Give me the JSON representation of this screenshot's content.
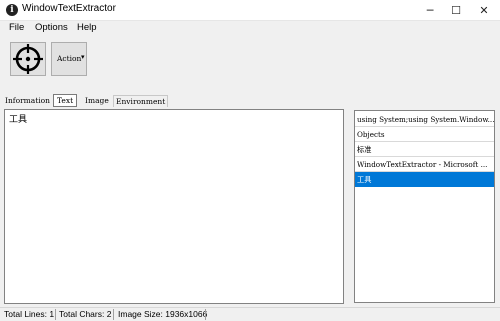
{
  "window": {
    "title": "WindowTextExtractor",
    "app_icon_glyph": "i",
    "minimize_glyph": "─",
    "maximize_glyph": "☐",
    "close_glyph": "✕"
  },
  "menu": {
    "items": [
      "File",
      "Options",
      "Help"
    ]
  },
  "toolbar": {
    "target_icon": "crosshair-target-icon",
    "action_label": "Action",
    "action_dropdown_glyph": "▾"
  },
  "tabs": {
    "items": [
      "Information",
      "Text",
      "Image",
      "Environment"
    ],
    "selected": "Text"
  },
  "text_panel": {
    "content": "工具"
  },
  "list": {
    "items": [
      "using System;using System.Window...",
      "Objects",
      "标准",
      "WindowTextExtractor - Microsoft ...",
      "工具"
    ],
    "selected_index": 4
  },
  "status": {
    "total_lines": "Total Lines: 1",
    "total_chars": "Total Chars: 2",
    "image_size": "Image Size: 1936x1066"
  },
  "colors": {
    "selection": "#0078d7",
    "background": "#f0f0f0"
  }
}
